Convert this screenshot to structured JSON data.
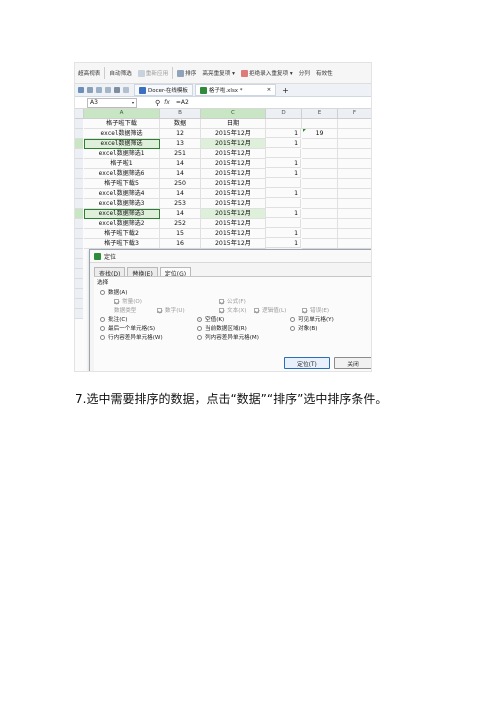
{
  "toolbar": {
    "items": [
      "超高视表",
      "自动筛选",
      "重新应用",
      "排序",
      "高亮重复项 ▾",
      "拒绝录入重复项 ▾",
      "分列",
      "有效性"
    ]
  },
  "tabs": {
    "doc1": "Docer-在线模板",
    "doc2": "格子啦.xlsx *",
    "close": "×",
    "plus": "+"
  },
  "formula_bar": {
    "name_box": "A3",
    "fx": "fx",
    "value": "=A2"
  },
  "columns": [
    "A",
    "B",
    "C",
    "D",
    "E",
    "F"
  ],
  "headers": [
    "格子啦下载",
    "数据",
    "日期"
  ],
  "rows": [
    {
      "a": "excel数据筛选",
      "b": "12",
      "c": "2015年12月",
      "d": "1",
      "e": "19"
    },
    {
      "a": "excel数据筛选",
      "b": "13",
      "c": "2015年12月",
      "d": "1",
      "e": ""
    },
    {
      "a": "excel数据筛选1",
      "b": "251",
      "c": "2015年12月",
      "d": "",
      "e": ""
    },
    {
      "a": "格子啦1",
      "b": "14",
      "c": "2015年12月",
      "d": "1",
      "e": ""
    },
    {
      "a": "excel数据筛选6",
      "b": "14",
      "c": "2015年12月",
      "d": "1",
      "e": ""
    },
    {
      "a": "格子啦下载5",
      "b": "250",
      "c": "2015年12月",
      "d": "",
      "e": ""
    },
    {
      "a": "excel数据筛选4",
      "b": "14",
      "c": "2015年12月",
      "d": "1",
      "e": ""
    },
    {
      "a": "excel数据筛选3",
      "b": "253",
      "c": "2015年12月",
      "d": "",
      "e": ""
    },
    {
      "a": "excel数据筛选3",
      "b": "14",
      "c": "2015年12月",
      "d": "1",
      "e": ""
    },
    {
      "a": "excel数据筛选2",
      "b": "252",
      "c": "2015年12月",
      "d": "",
      "e": ""
    },
    {
      "a": "格子啦下载2",
      "b": "15",
      "c": "2015年12月",
      "d": "1",
      "e": ""
    },
    {
      "a": "格子啦下载3",
      "b": "16",
      "c": "2015年12月",
      "d": "1",
      "e": ""
    }
  ],
  "dialog": {
    "title": "定位",
    "tabs": [
      "查找(D)",
      "替换(E)",
      "定位(G)"
    ],
    "group_label": "选择",
    "data": "数据(A)",
    "constant": "常量(O)",
    "formula": "公式(F)",
    "data_type": "数据类型",
    "number": "数字(U)",
    "text": "文本(X)",
    "logical": "逻辑值(L)",
    "error": "错误(E)",
    "comment": "批注(C)",
    "blank": "空值(K)",
    "visible": "可见单元格(Y)",
    "last_cell": "最后一个单元格(S)",
    "current_region": "当前数据区域(R)",
    "object": "对象(B)",
    "row_diff": "行内容差异单元格(W)",
    "col_diff": "列内容差异单元格(M)",
    "locate_button": "定位(T)",
    "close_button": "关闭"
  },
  "caption": "7.选中需要排序的数据，点击“数据”“排序”选中排序条件。",
  "colors": {
    "accent_green": "#2e8b3a",
    "selection_fill": "#dff0da"
  }
}
